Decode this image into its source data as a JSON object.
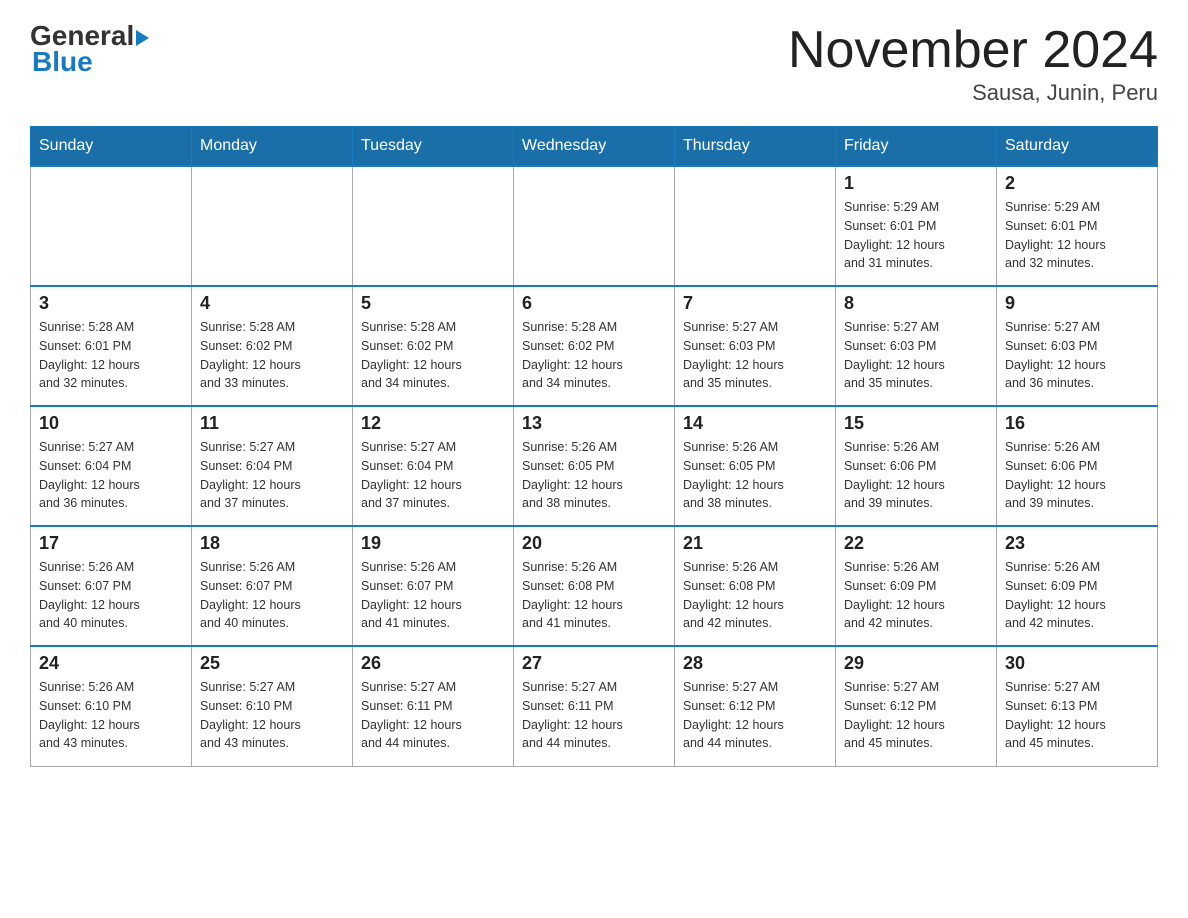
{
  "header": {
    "logo_general": "General",
    "logo_blue": "Blue",
    "title": "November 2024",
    "subtitle": "Sausa, Junin, Peru"
  },
  "days_of_week": [
    "Sunday",
    "Monday",
    "Tuesday",
    "Wednesday",
    "Thursday",
    "Friday",
    "Saturday"
  ],
  "weeks": [
    {
      "days": [
        {
          "number": "",
          "info": ""
        },
        {
          "number": "",
          "info": ""
        },
        {
          "number": "",
          "info": ""
        },
        {
          "number": "",
          "info": ""
        },
        {
          "number": "",
          "info": ""
        },
        {
          "number": "1",
          "info": "Sunrise: 5:29 AM\nSunset: 6:01 PM\nDaylight: 12 hours\nand 31 minutes."
        },
        {
          "number": "2",
          "info": "Sunrise: 5:29 AM\nSunset: 6:01 PM\nDaylight: 12 hours\nand 32 minutes."
        }
      ]
    },
    {
      "days": [
        {
          "number": "3",
          "info": "Sunrise: 5:28 AM\nSunset: 6:01 PM\nDaylight: 12 hours\nand 32 minutes."
        },
        {
          "number": "4",
          "info": "Sunrise: 5:28 AM\nSunset: 6:02 PM\nDaylight: 12 hours\nand 33 minutes."
        },
        {
          "number": "5",
          "info": "Sunrise: 5:28 AM\nSunset: 6:02 PM\nDaylight: 12 hours\nand 34 minutes."
        },
        {
          "number": "6",
          "info": "Sunrise: 5:28 AM\nSunset: 6:02 PM\nDaylight: 12 hours\nand 34 minutes."
        },
        {
          "number": "7",
          "info": "Sunrise: 5:27 AM\nSunset: 6:03 PM\nDaylight: 12 hours\nand 35 minutes."
        },
        {
          "number": "8",
          "info": "Sunrise: 5:27 AM\nSunset: 6:03 PM\nDaylight: 12 hours\nand 35 minutes."
        },
        {
          "number": "9",
          "info": "Sunrise: 5:27 AM\nSunset: 6:03 PM\nDaylight: 12 hours\nand 36 minutes."
        }
      ]
    },
    {
      "days": [
        {
          "number": "10",
          "info": "Sunrise: 5:27 AM\nSunset: 6:04 PM\nDaylight: 12 hours\nand 36 minutes."
        },
        {
          "number": "11",
          "info": "Sunrise: 5:27 AM\nSunset: 6:04 PM\nDaylight: 12 hours\nand 37 minutes."
        },
        {
          "number": "12",
          "info": "Sunrise: 5:27 AM\nSunset: 6:04 PM\nDaylight: 12 hours\nand 37 minutes."
        },
        {
          "number": "13",
          "info": "Sunrise: 5:26 AM\nSunset: 6:05 PM\nDaylight: 12 hours\nand 38 minutes."
        },
        {
          "number": "14",
          "info": "Sunrise: 5:26 AM\nSunset: 6:05 PM\nDaylight: 12 hours\nand 38 minutes."
        },
        {
          "number": "15",
          "info": "Sunrise: 5:26 AM\nSunset: 6:06 PM\nDaylight: 12 hours\nand 39 minutes."
        },
        {
          "number": "16",
          "info": "Sunrise: 5:26 AM\nSunset: 6:06 PM\nDaylight: 12 hours\nand 39 minutes."
        }
      ]
    },
    {
      "days": [
        {
          "number": "17",
          "info": "Sunrise: 5:26 AM\nSunset: 6:07 PM\nDaylight: 12 hours\nand 40 minutes."
        },
        {
          "number": "18",
          "info": "Sunrise: 5:26 AM\nSunset: 6:07 PM\nDaylight: 12 hours\nand 40 minutes."
        },
        {
          "number": "19",
          "info": "Sunrise: 5:26 AM\nSunset: 6:07 PM\nDaylight: 12 hours\nand 41 minutes."
        },
        {
          "number": "20",
          "info": "Sunrise: 5:26 AM\nSunset: 6:08 PM\nDaylight: 12 hours\nand 41 minutes."
        },
        {
          "number": "21",
          "info": "Sunrise: 5:26 AM\nSunset: 6:08 PM\nDaylight: 12 hours\nand 42 minutes."
        },
        {
          "number": "22",
          "info": "Sunrise: 5:26 AM\nSunset: 6:09 PM\nDaylight: 12 hours\nand 42 minutes."
        },
        {
          "number": "23",
          "info": "Sunrise: 5:26 AM\nSunset: 6:09 PM\nDaylight: 12 hours\nand 42 minutes."
        }
      ]
    },
    {
      "days": [
        {
          "number": "24",
          "info": "Sunrise: 5:26 AM\nSunset: 6:10 PM\nDaylight: 12 hours\nand 43 minutes."
        },
        {
          "number": "25",
          "info": "Sunrise: 5:27 AM\nSunset: 6:10 PM\nDaylight: 12 hours\nand 43 minutes."
        },
        {
          "number": "26",
          "info": "Sunrise: 5:27 AM\nSunset: 6:11 PM\nDaylight: 12 hours\nand 44 minutes."
        },
        {
          "number": "27",
          "info": "Sunrise: 5:27 AM\nSunset: 6:11 PM\nDaylight: 12 hours\nand 44 minutes."
        },
        {
          "number": "28",
          "info": "Sunrise: 5:27 AM\nSunset: 6:12 PM\nDaylight: 12 hours\nand 44 minutes."
        },
        {
          "number": "29",
          "info": "Sunrise: 5:27 AM\nSunset: 6:12 PM\nDaylight: 12 hours\nand 45 minutes."
        },
        {
          "number": "30",
          "info": "Sunrise: 5:27 AM\nSunset: 6:13 PM\nDaylight: 12 hours\nand 45 minutes."
        }
      ]
    }
  ]
}
